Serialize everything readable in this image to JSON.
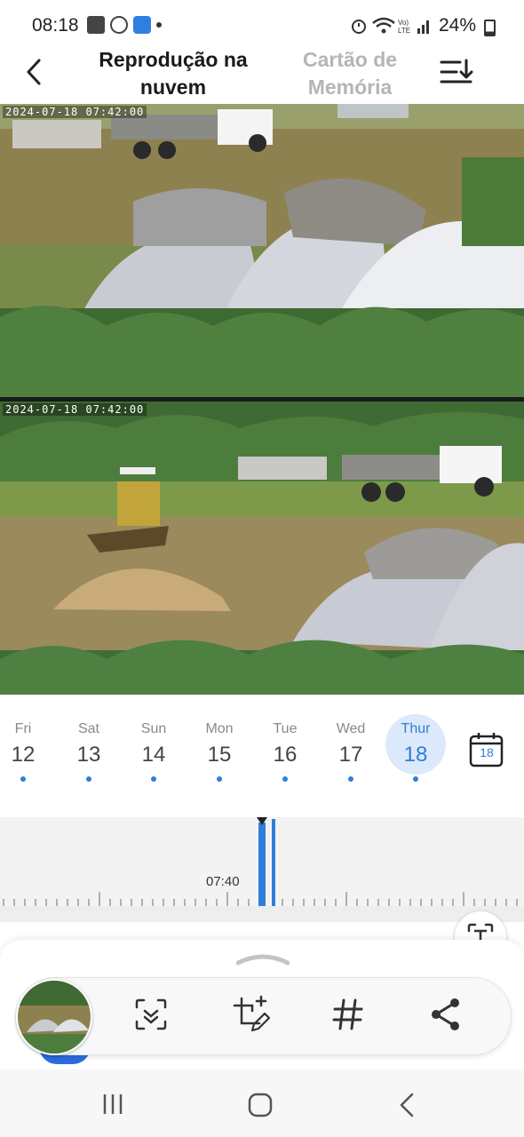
{
  "status_bar": {
    "time": "08:18",
    "battery": "24%",
    "icons": [
      "gallery-icon",
      "whatsapp-icon",
      "app-notification-icon",
      "dot-icon",
      "alarm-icon",
      "wifi-icon",
      "volte-icon",
      "signal-icon",
      "battery-icon"
    ]
  },
  "header": {
    "back_icon": "back-arrow-icon",
    "tab_cloud": "Reprodução na nuvem",
    "tab_sd": "Cartão de Memória",
    "sort_icon": "sort-download-icon"
  },
  "feeds": [
    {
      "timestamp": "2024-07-18  07:42:00"
    },
    {
      "timestamp": "2024-07-18  07:42:00"
    }
  ],
  "days": [
    {
      "name": "Fri",
      "num": "12",
      "has_recording": true
    },
    {
      "name": "Sat",
      "num": "13",
      "has_recording": true
    },
    {
      "name": "Sun",
      "num": "14",
      "has_recording": true
    },
    {
      "name": "Mon",
      "num": "15",
      "has_recording": true
    },
    {
      "name": "Tue",
      "num": "16",
      "has_recording": true
    },
    {
      "name": "Wed",
      "num": "17",
      "has_recording": true
    },
    {
      "name": "Thur",
      "num": "18",
      "has_recording": true,
      "selected": true
    }
  ],
  "calendar": {
    "icon": "calendar-icon",
    "day": "18"
  },
  "timeline": {
    "label": "07:40"
  },
  "toolbar": {
    "icons": [
      "scan-icon",
      "crop-edit-icon",
      "hashtag-icon",
      "share-icon"
    ]
  },
  "colors": {
    "accent": "#2e7fd9",
    "selected_bg": "#dbe9fb"
  }
}
